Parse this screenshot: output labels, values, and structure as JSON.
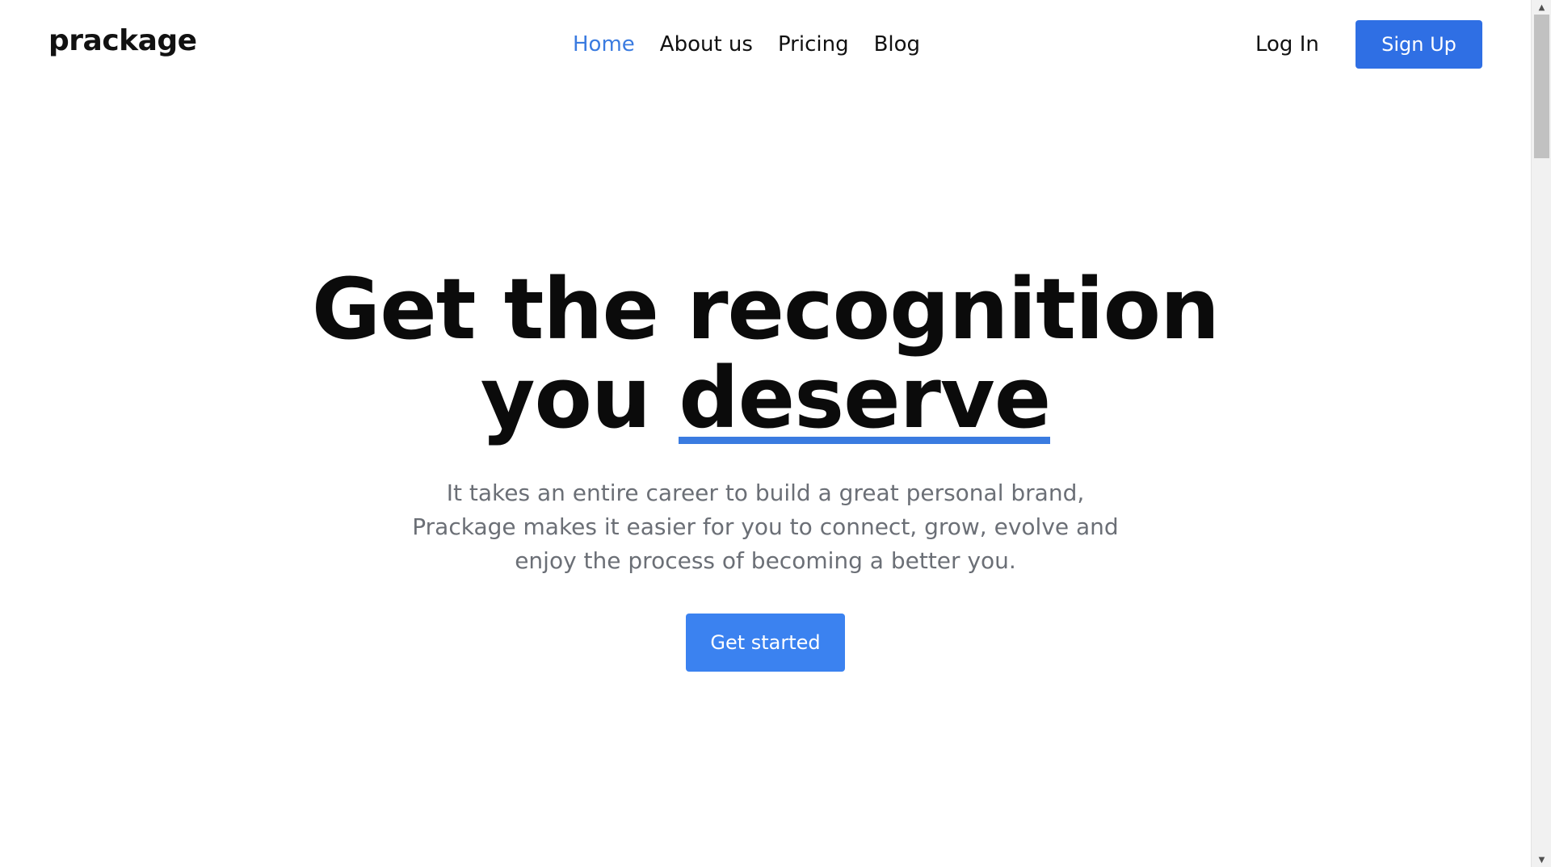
{
  "header": {
    "logo": "prackage",
    "nav": [
      {
        "label": "Home",
        "active": true
      },
      {
        "label": "About us",
        "active": false
      },
      {
        "label": "Pricing",
        "active": false
      },
      {
        "label": "Blog",
        "active": false
      }
    ],
    "login_label": "Log In",
    "signup_label": "Sign Up"
  },
  "hero": {
    "title_line1": "Get the recognition",
    "title_line2_prefix": "you ",
    "title_line2_highlight": "deserve",
    "subtitle_lines": [
      "It takes an entire career to build a great personal brand,",
      "Prackage makes it easier for you to connect, grow, evolve and",
      "enjoy the process of becoming a better you."
    ],
    "cta_label": "Get started"
  },
  "scrollbar": {
    "up_icon": "triangle-up-icon",
    "down_icon": "triangle-down-icon"
  },
  "colors": {
    "accent": "#3a7be0",
    "button": "#2f6fe4",
    "text": "#111111",
    "muted": "#6b6f76"
  }
}
